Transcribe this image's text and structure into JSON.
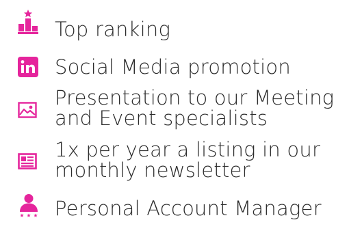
{
  "accent_color": "#e5259c",
  "items": [
    {
      "icon": "trophy-podium-icon",
      "text": "Top ranking"
    },
    {
      "icon": "linkedin-icon",
      "text": "Social Media promotion"
    },
    {
      "icon": "image-icon",
      "line1": "Presentation to our Meeting",
      "line2": "and Event specialists"
    },
    {
      "icon": "newspaper-icon",
      "line1": "1x per year a listing in our",
      "line2": "monthly newsletter"
    },
    {
      "icon": "account-manager-icon",
      "text": "Personal Account Manager"
    }
  ]
}
